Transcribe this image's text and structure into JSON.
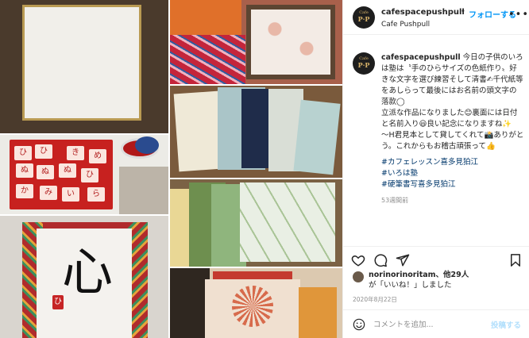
{
  "header": {
    "username": "cafespacepushpull",
    "dot": "•",
    "follow_label": "フォローする",
    "location": "Cafe Pushpull",
    "more": "•••"
  },
  "avatar": {
    "line1": "Cafe",
    "line2": "P·P"
  },
  "caption": {
    "username": "cafespacepushpull",
    "lines": [
      " 今日の子供のいろは塾は〝手のひらサイズの色紙作り〟好きな文字を選び練習そして清書✍千代紙等をあしらって最後にはお名前の頭文字の落款◯",
      "立派な作品になりました😊裏面には日付と名前入り😃良い記念になりますね✨",
      "〜H君見本として貸してくれて📸ありがとう。これからもお稽古頑張って👍"
    ],
    "hashtags": [
      "#カフェレッスン喜多見狛江",
      "#いろは塾",
      "#硬筆書写喜多見狛江"
    ],
    "time": "53週間前"
  },
  "likes": {
    "user": "norinorinoritam",
    "suffix": "、他29人",
    "line2": "が「いいね！」しました"
  },
  "date": "2020年8月22日",
  "comment": {
    "placeholder": "コメントを追加...",
    "post_label": "投稿する"
  },
  "photo": {
    "kanji": "心",
    "seal": "ひ",
    "stamps": [
      "ひ",
      "ひ",
      "き",
      "め",
      "ぬ",
      "ぬ",
      "ぬ",
      "ひ",
      "か",
      "み",
      "い",
      "ら"
    ]
  },
  "colors": {
    "accent": "#0095f6",
    "hashtag": "#00376b",
    "muted": "#8e8e8e",
    "post_disabled": "#b2dffc"
  },
  "icons": [
    "heart-icon",
    "comment-icon",
    "share-icon",
    "bookmark-icon",
    "emoji-icon",
    "more-icon"
  ]
}
